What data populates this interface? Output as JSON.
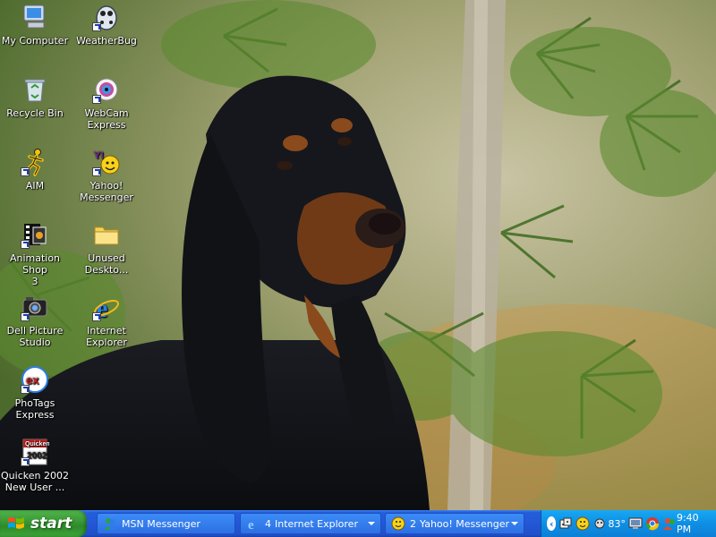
{
  "desktop": {
    "icons": [
      {
        "label": "My Computer",
        "icon": "my-computer-icon"
      },
      {
        "label": "WeatherBug",
        "icon": "weatherbug-icon"
      },
      {
        "label": "Recycle Bin",
        "icon": "recycle-bin-icon"
      },
      {
        "label": "WebCam\nExpress",
        "icon": "webcam-icon"
      },
      {
        "label": "AIM",
        "icon": "aim-running-man-icon"
      },
      {
        "label": "Yahoo!\nMessenger",
        "icon": "yahoo-messenger-icon"
      },
      {
        "label": "Animation Shop\n3",
        "icon": "animation-shop-icon"
      },
      {
        "label": "Unused\nDeskto...",
        "icon": "folder-icon"
      },
      {
        "label": "Dell Picture\nStudio",
        "icon": "dell-picture-studio-icon"
      },
      {
        "label": "Internet\nExplorer",
        "icon": "internet-explorer-icon"
      },
      {
        "label": "PhoTags\nExpress",
        "icon": "photags-icon"
      },
      {
        "label": "Quicken 2002\nNew User ...",
        "icon": "quicken-icon"
      }
    ]
  },
  "taskbar": {
    "start_label": "start",
    "buttons": [
      {
        "label": "MSN Messenger",
        "count": "",
        "icon": "msn-messenger-icon"
      },
      {
        "label": "Internet Explorer",
        "count": "4",
        "icon": "internet-explorer-icon"
      },
      {
        "label": "Yahoo! Messenger",
        "count": "2",
        "icon": "yahoo-smiley-icon"
      }
    ],
    "tray": {
      "expand_glyph": "‹",
      "temperature": "83°",
      "time": "9:40 PM",
      "icons": [
        "dice-icon",
        "yahoo-smiley-icon",
        "weather-icon",
        "monitor-icon",
        "chrome-like-icon",
        "msn-people-icon"
      ]
    }
  },
  "colors": {
    "taskbar_blue": "#245edb",
    "start_green": "#3c9a37",
    "tray_blue": "#0f8fe4"
  }
}
